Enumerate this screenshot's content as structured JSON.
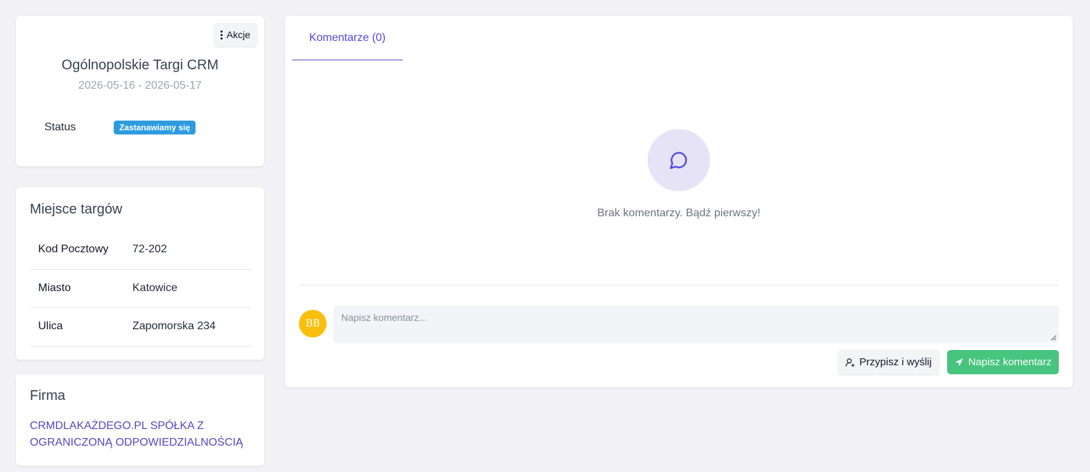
{
  "event": {
    "actions_label": "Akcje",
    "title": "Ogólnopolskie Targi CRM",
    "dates": "2026-05-16 - 2026-05-17",
    "status_label": "Status",
    "status_value": "Zastanawiamy się",
    "status_color": "#2d9be0"
  },
  "venue": {
    "heading": "Miejsce targów",
    "rows": [
      {
        "key": "Kod Pocztowy",
        "value": "72-202"
      },
      {
        "key": "Miasto",
        "value": "Katowice"
      },
      {
        "key": "Ulica",
        "value": "Zapomorska 234"
      }
    ]
  },
  "company": {
    "heading": "Firma",
    "name": "CRMDLAKAŻDEGO.PL SPÓŁKA Z OGRANICZONĄ ODPOWIEDZIALNOŚCIĄ"
  },
  "comments": {
    "tab_label": "Komentarze (0)",
    "empty_text": "Brak komentarzy. Bądź pierwszy!",
    "avatar_initials": "BB",
    "input_placeholder": "Napisz komentarz...",
    "assign_button_label": "Przypisz i wyślij",
    "submit_button_label": "Napisz komentarz"
  },
  "colors": {
    "accent": "#4f46e5",
    "success": "#47c47e",
    "avatar": "#f8bf0e"
  },
  "icons": {
    "actions": "kebab-icon",
    "empty_state": "chat-bubble-icon",
    "assign": "user-plus-icon",
    "submit": "send-icon"
  }
}
